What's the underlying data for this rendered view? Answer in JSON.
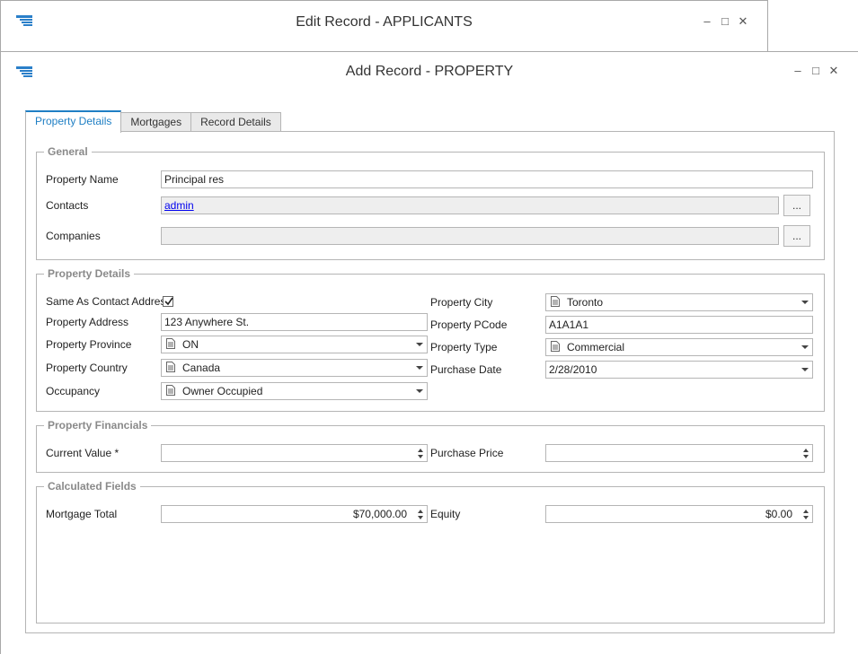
{
  "back_window": {
    "title": "Edit Record - APPLICANTS"
  },
  "front_window": {
    "title": "Add Record - PROPERTY"
  },
  "window_controls": {
    "minimize": "–",
    "maximize": "□",
    "close": "✕"
  },
  "tabs": [
    {
      "label": "Property Details",
      "active": true
    },
    {
      "label": "Mortgages",
      "active": false
    },
    {
      "label": "Record Details",
      "active": false
    }
  ],
  "general": {
    "title": "General",
    "property_name_label": "Property Name",
    "property_name_value": "Principal res",
    "contacts_label": "Contacts",
    "contacts_value": "admin",
    "companies_label": "Companies",
    "companies_value": "",
    "ellipsis": "..."
  },
  "property_details": {
    "title": "Property Details",
    "same_as_contact_label": "Same As Contact Address",
    "same_as_contact_checked": true,
    "address_label": "Property Address",
    "address_value": "123 Anywhere St.",
    "province_label": "Property Province",
    "province_value": "ON",
    "country_label": "Property Country",
    "country_value": "Canada",
    "occupancy_label": "Occupancy",
    "occupancy_value": "Owner Occupied",
    "city_label": "Property City",
    "city_value": "Toronto",
    "pcode_label": "Property PCode",
    "pcode_value": "A1A1A1",
    "type_label": "Property Type",
    "type_value": "Commercial",
    "purchase_date_label": "Purchase Date",
    "purchase_date_value": "2/28/2010"
  },
  "financials": {
    "title": "Property Financials",
    "current_value_label": "Current Value *",
    "current_value": "",
    "purchase_price_label": "Purchase Price",
    "purchase_price": ""
  },
  "calculated": {
    "title": "Calculated Fields",
    "mortgage_total_label": "Mortgage Total",
    "mortgage_total": "$70,000.00",
    "equity_label": "Equity",
    "equity": "$0.00"
  },
  "colors": {
    "accent": "#1f7fc4",
    "border": "#b5b5b5",
    "group_title": "#8a8a8a"
  }
}
